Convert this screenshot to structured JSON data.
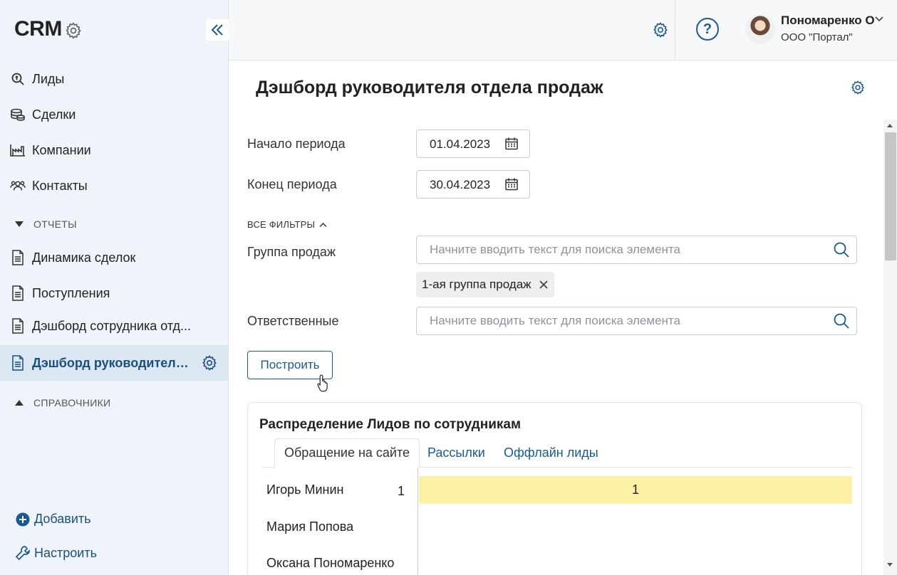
{
  "app": {
    "title": "CRM"
  },
  "sidebar": {
    "nav": [
      {
        "label": "Лиды",
        "icon": "search-money-icon"
      },
      {
        "label": "Сделки",
        "icon": "coins-icon"
      },
      {
        "label": "Компании",
        "icon": "factory-icon"
      },
      {
        "label": "Контакты",
        "icon": "people-icon"
      }
    ],
    "reports_section": "ОТЧЕТЫ",
    "reports": [
      {
        "label": "Динамика сделок",
        "icon": "document-icon"
      },
      {
        "label": "Поступления",
        "icon": "document-icon"
      },
      {
        "label": "Дэшборд сотрудника отд...",
        "icon": "document-icon"
      },
      {
        "label": "Дэшборд руководителя ...",
        "icon": "document-icon",
        "active": true
      }
    ],
    "refs_section": "СПРАВОЧНИКИ",
    "add_label": "Добавить",
    "configure_label": "Настроить"
  },
  "topbar": {
    "user_name": "Пономаренко О",
    "user_org": "ООО \"Портал\""
  },
  "main": {
    "title": "Дэшборд руководителя отдела продаж",
    "period_start_label": "Начало периода",
    "period_start_value": "01.04.2023",
    "period_end_label": "Конец периода",
    "period_end_value": "30.04.2023",
    "all_filters_label": "ВСЕ ФИЛЬТРЫ",
    "sales_group_label": "Группа продаж",
    "search_placeholder": "Начните вводить текст для поиска элемента",
    "selected_group_chip": "1-ая группа продаж",
    "responsible_label": "Ответственные",
    "build_button": "Построить"
  },
  "card": {
    "title": "Распределение Лидов по сотрудникам",
    "tabs": [
      "Обращение на сайте",
      "Рассылки",
      "Оффлайн лиды"
    ],
    "active_tab": 0,
    "rows": [
      {
        "name": "Игорь Минин",
        "count": "1",
        "bar_value": "1",
        "bar_fraction": 1.0
      },
      {
        "name": "Мария Попова",
        "count": "",
        "bar_value": "",
        "bar_fraction": 0
      },
      {
        "name": "Оксана Пономаренко",
        "count": "",
        "bar_value": "",
        "bar_fraction": 0
      }
    ],
    "bar_color": "#fbf0a3"
  },
  "colors": {
    "accent": "#1a5a94",
    "sidebar_bg": "#eef4fa",
    "active_item_bg": "#dbe7f2"
  }
}
